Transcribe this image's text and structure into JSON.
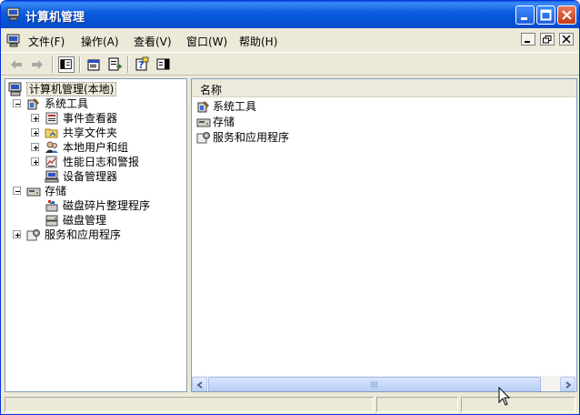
{
  "window": {
    "title": "计算机管理",
    "title_icon": "computer-management-icon"
  },
  "menubar": {
    "items": [
      {
        "label": "文件(F)"
      },
      {
        "label": "操作(A)"
      },
      {
        "label": "查看(V)"
      },
      {
        "label": "窗口(W)"
      },
      {
        "label": "帮助(H)"
      }
    ]
  },
  "toolbar": {
    "buttons": [
      "back-icon",
      "forward-icon",
      "show-hide-tree-icon",
      "properties-icon",
      "export-list-icon",
      "help-icon",
      "show-hide-action-pane-icon"
    ]
  },
  "tree": {
    "root": {
      "label": "计算机管理(本地)"
    },
    "items": [
      {
        "label": "系统工具",
        "expander": "−"
      },
      {
        "label": "事件查看器",
        "expander": "+"
      },
      {
        "label": "共享文件夹",
        "expander": "+"
      },
      {
        "label": "本地用户和组",
        "expander": "+"
      },
      {
        "label": "性能日志和警报",
        "expander": "+"
      },
      {
        "label": "设备管理器"
      },
      {
        "label": "存储",
        "expander": "−"
      },
      {
        "label": "磁盘碎片整理程序"
      },
      {
        "label": "磁盘管理"
      },
      {
        "label": "服务和应用程序",
        "expander": "+"
      }
    ]
  },
  "list": {
    "column_header": "名称",
    "rows": [
      {
        "label": "系统工具"
      },
      {
        "label": "存储"
      },
      {
        "label": "服务和应用程序"
      }
    ]
  },
  "colors": {
    "titlebar": "#0a5fe8",
    "selection": "#ece9d8"
  }
}
